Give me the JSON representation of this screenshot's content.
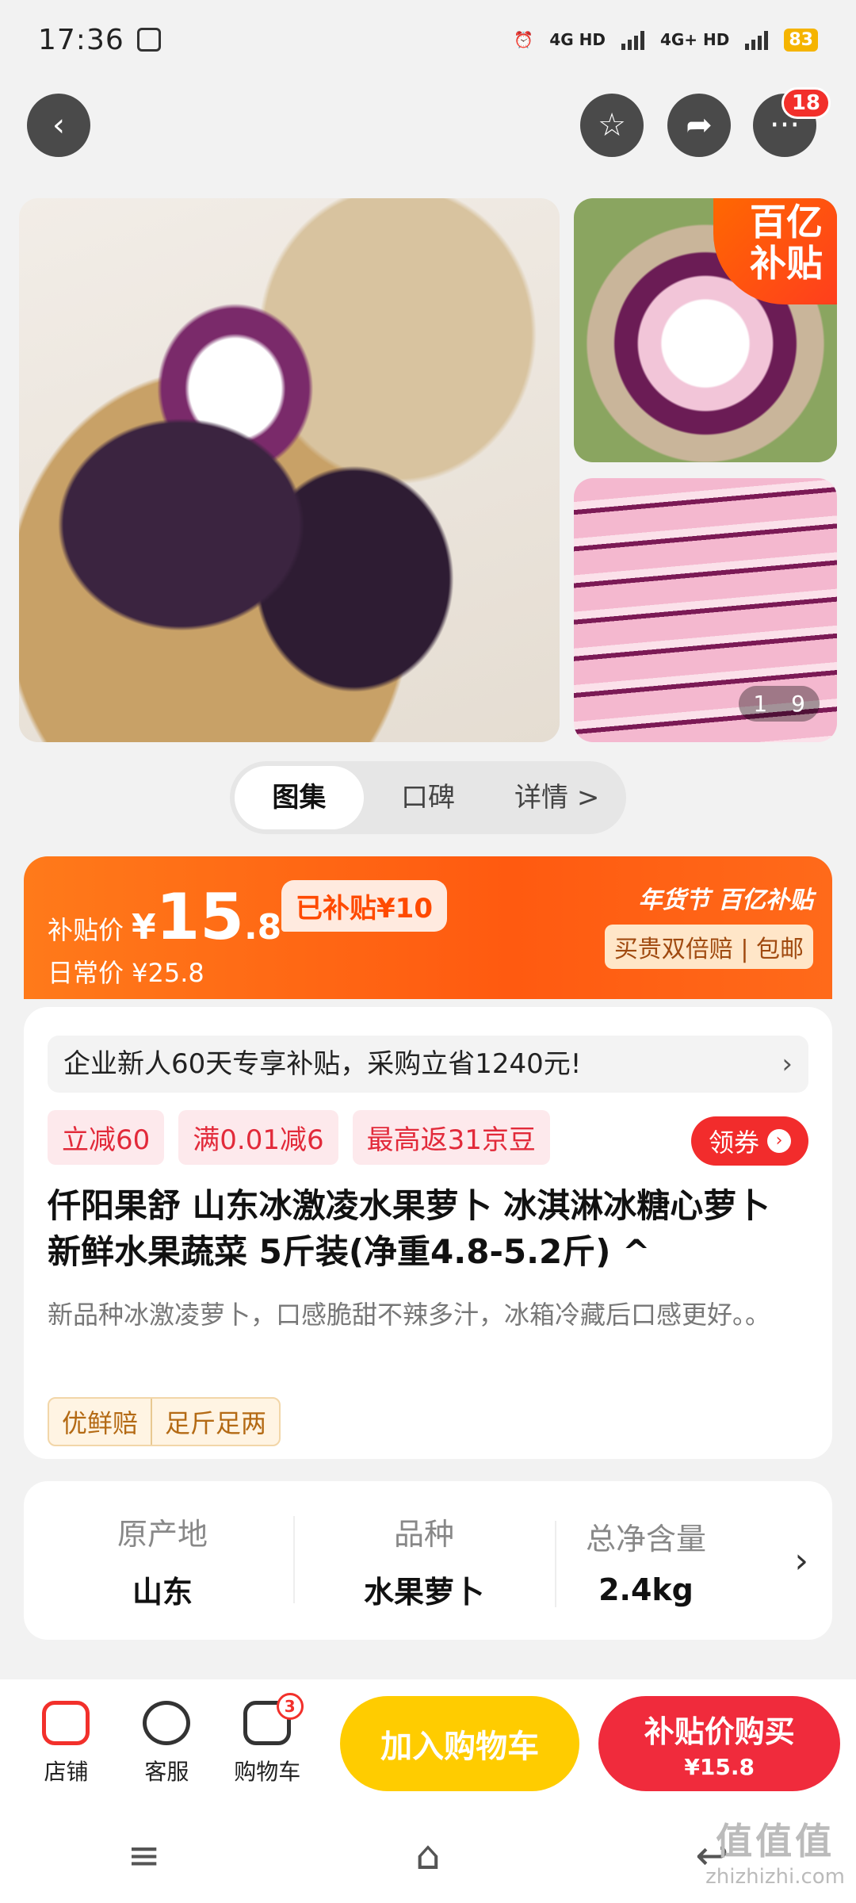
{
  "status_bar": {
    "time": "17:36",
    "network1": "4G HD",
    "network2": "4G+ HD",
    "battery": "83"
  },
  "header": {
    "more_badge": "18"
  },
  "gallery": {
    "promo_corner_line1": "百亿",
    "promo_corner_line2": "补贴",
    "counter_current": "1",
    "counter_total": "9"
  },
  "tabs": [
    {
      "label": "图集"
    },
    {
      "label": "口碑"
    },
    {
      "label": "详情 >"
    }
  ],
  "price": {
    "label": "补贴价",
    "yen": "¥",
    "integer": "15",
    "decimal": ".8",
    "subsidized": "已补贴¥10",
    "daily": "日常价 ¥25.8",
    "event": "年货节 百亿补贴",
    "guarantee": "买贵双倍赔 | 包邮"
  },
  "notice": {
    "text": "企业新人60天专享补贴，采购立省1240元!",
    "chevron": "›"
  },
  "coupons": [
    {
      "label": "立减60"
    },
    {
      "label": "满0.01减6"
    },
    {
      "label": "最高返31京豆"
    }
  ],
  "claim_button": {
    "label": "领券",
    "arrow": "›"
  },
  "product": {
    "title": "仟阳果舒 山东冰激凌水果萝卜 冰淇淋冰糖心萝卜 新鲜水果蔬菜 5斤装(净重4.8-5.2斤) ^",
    "description": "新品种冰激凌萝卜，口感脆甜不辣多汁，冰箱冷藏后口感更好。。",
    "tags": [
      "优鲜赔",
      "足斤足两"
    ]
  },
  "specs": [
    {
      "key": "原产地",
      "value": "山东"
    },
    {
      "key": "品种",
      "value": "水果萝卜"
    },
    {
      "key": "总净含量",
      "value": "2.4kg"
    }
  ],
  "bottom_bar": {
    "store": "店铺",
    "service": "客服",
    "cart": "购物车",
    "cart_count": "3",
    "add_to_cart": "加入购物车",
    "buy_line1": "补贴价购买",
    "buy_line2": "¥15.8"
  },
  "system_nav": {
    "menu": "≡",
    "home": "⌂",
    "back": "↩"
  },
  "watermark": {
    "line1": "值值值",
    "line2": "zhizhizhi.com"
  },
  "colors": {
    "accent_orange": "#ff5a10",
    "accent_red": "#f02b3c",
    "cart_yellow": "#ffcc00"
  }
}
